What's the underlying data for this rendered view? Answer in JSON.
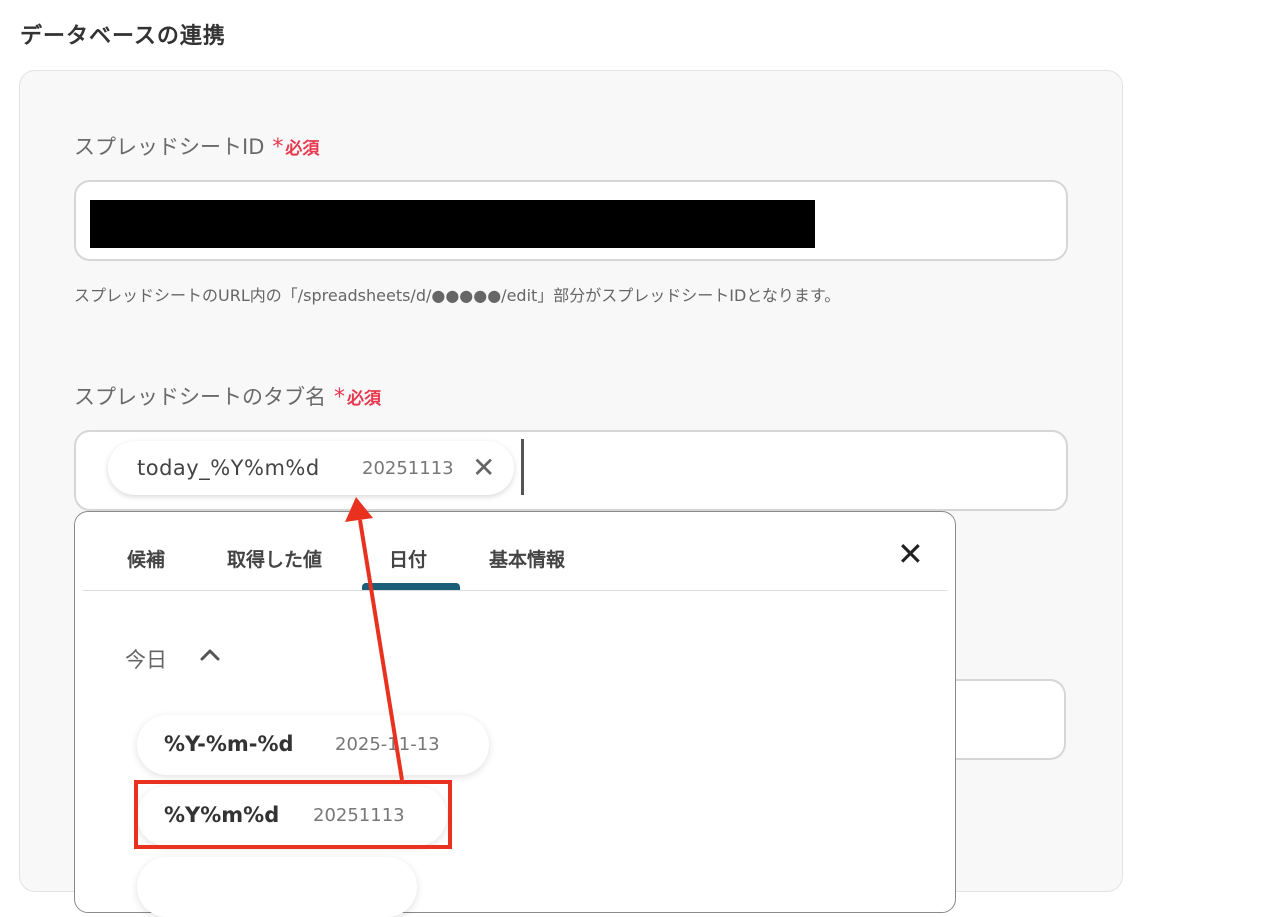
{
  "page": {
    "title": "データベースの連携"
  },
  "spreadsheet_id": {
    "label": "スプレッドシートID",
    "required_mark": "*",
    "required_text": "必須",
    "value": "",
    "help": "スプレッドシートのURL内の「/spreadsheets/d/●●●●●/edit」部分がスプレッドシートIDとなります。"
  },
  "tab_name": {
    "label": "スプレッドシートのタブ名",
    "required_mark": "*",
    "required_text": "必須",
    "chip": {
      "name": "today_%Y%m%d",
      "value": "20251113",
      "remove": "✕"
    }
  },
  "picker": {
    "tabs": [
      "候補",
      "取得した値",
      "日付",
      "基本情報"
    ],
    "active_tab": "日付",
    "close": "✕",
    "section": {
      "label": "今日",
      "chevron": "^"
    },
    "options": [
      {
        "name": "%Y-%m-%d",
        "value": "2025-11-13"
      },
      {
        "name": "%Y%m%d",
        "value": "20251113"
      }
    ]
  },
  "colors": {
    "accent": "#1a5e7a",
    "required": "#e8384f",
    "annotation": "#e8321f"
  }
}
